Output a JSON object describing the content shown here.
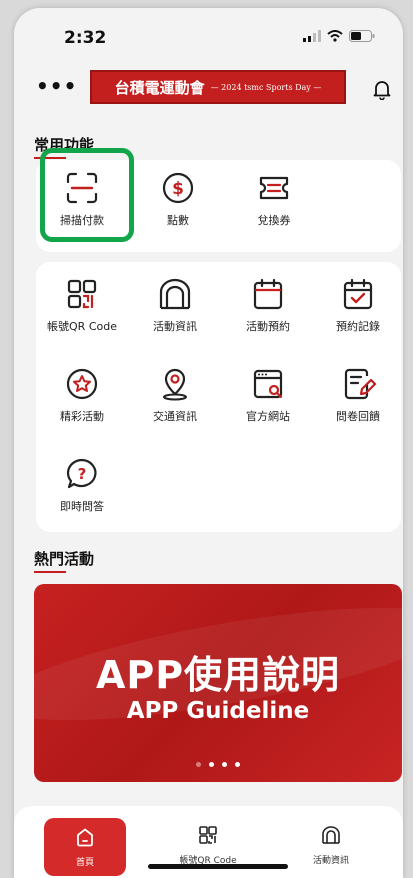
{
  "status": {
    "time": "2:32"
  },
  "header": {
    "more": "•••",
    "banner_title": "台積電運動會",
    "banner_subtitle": "— 2024 tsmc Sports Day —"
  },
  "common_functions": {
    "title": "常用功能",
    "items": [
      {
        "label": "掃描付款",
        "icon": "scan-icon"
      },
      {
        "label": "點數",
        "icon": "points-icon"
      },
      {
        "label": "兌換券",
        "icon": "ticket-icon"
      }
    ]
  },
  "services": {
    "items": [
      {
        "label": "帳號QR Code",
        "icon": "qr-code-icon"
      },
      {
        "label": "活動資訊",
        "icon": "stadium-icon"
      },
      {
        "label": "活動預約",
        "icon": "calendar-icon"
      },
      {
        "label": "預約記錄",
        "icon": "calendar-check-icon"
      },
      {
        "label": "精彩活動",
        "icon": "star-badge-icon"
      },
      {
        "label": "交通資訊",
        "icon": "location-icon"
      },
      {
        "label": "官方網站",
        "icon": "website-icon"
      },
      {
        "label": "問卷回饋",
        "icon": "survey-icon"
      },
      {
        "label": "即時問答",
        "icon": "help-icon"
      }
    ]
  },
  "hot_events": {
    "title": "熱門活動",
    "banner_title": "APP使用說明",
    "banner_subtitle": "APP Guideline"
  },
  "tabbar": {
    "tabs": [
      {
        "label": "首頁",
        "icon": "home-icon",
        "active": true
      },
      {
        "label": "帳號QR Code",
        "icon": "qr-code-icon"
      },
      {
        "label": "活動資訊",
        "icon": "stadium-icon"
      }
    ]
  },
  "colors": {
    "accent": "#c41f1f",
    "highlight": "#12a54a"
  }
}
